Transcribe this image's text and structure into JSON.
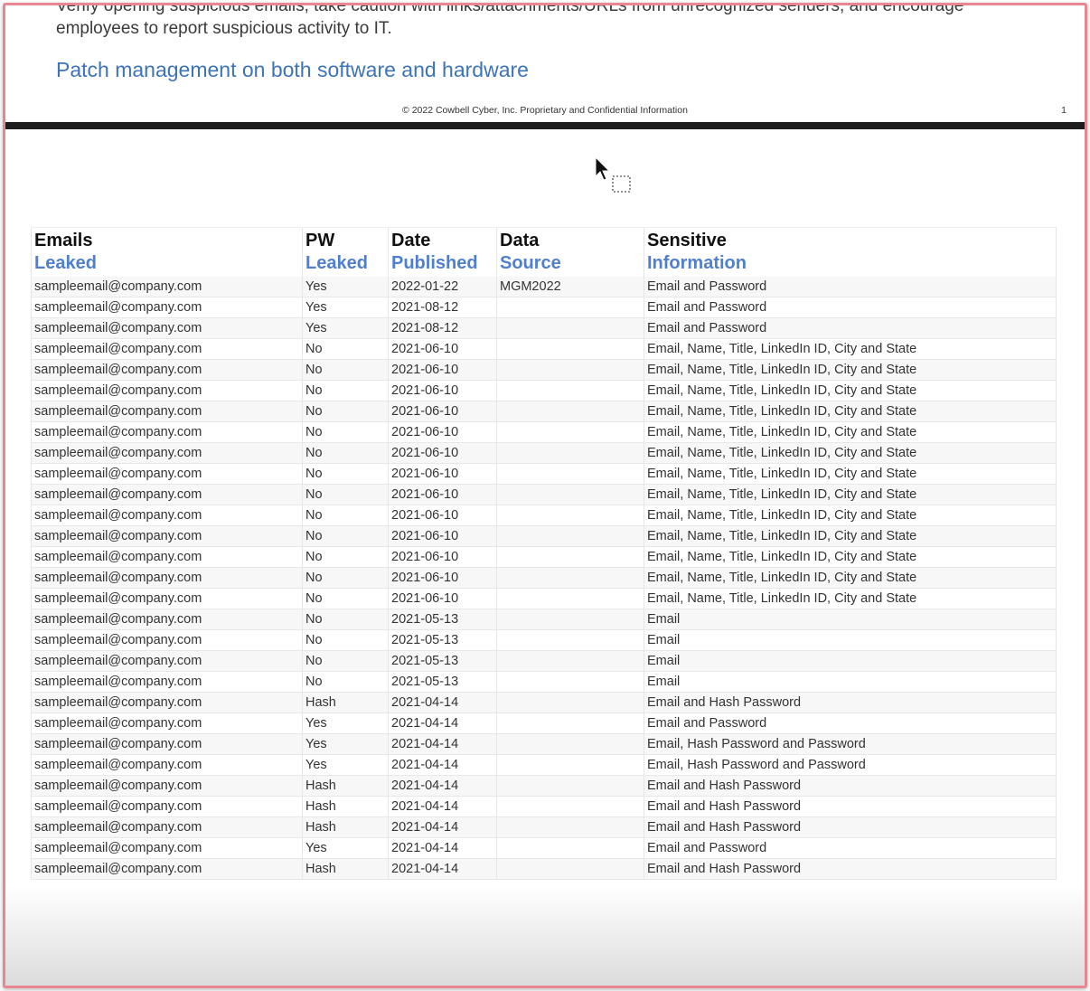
{
  "document": {
    "intro_text": "Verify opening suspicious emails, take caution with links/attachments/URLs from unrecognized senders, and encourage employees to report suspicious activity to IT.",
    "section_heading": "Patch management on both software and hardware",
    "footer_notice": "© 2022 Cowbell Cyber, Inc. Proprietary and Confidential Information",
    "page_number": "1"
  },
  "colors": {
    "heading_blue": "#3d74b8",
    "header_blue": "#4f7fcf",
    "frame_border": "#e8878f",
    "divider": "#1e1e1e"
  },
  "table": {
    "columns": [
      {
        "line1": "Emails",
        "line2": "Leaked"
      },
      {
        "line1": "PW",
        "line2": "Leaked"
      },
      {
        "line1": "Date",
        "line2": "Published"
      },
      {
        "line1": "Data",
        "line2": "Source"
      },
      {
        "line1": "Sensitive",
        "line2": "Information"
      }
    ],
    "rows": [
      [
        "sampleemail@company.com",
        "Yes",
        "2022-01-22",
        "MGM2022",
        "Email and Password"
      ],
      [
        "sampleemail@company.com",
        "Yes",
        "2021-08-12",
        "",
        "Email and Password"
      ],
      [
        "sampleemail@company.com",
        "Yes",
        "2021-08-12",
        "",
        "Email and Password"
      ],
      [
        "sampleemail@company.com",
        "No",
        "2021-06-10",
        "",
        "Email, Name, Title, LinkedIn ID, City and State"
      ],
      [
        "sampleemail@company.com",
        "No",
        "2021-06-10",
        "",
        "Email, Name, Title, LinkedIn ID, City and State"
      ],
      [
        "sampleemail@company.com",
        "No",
        "2021-06-10",
        "",
        "Email, Name, Title, LinkedIn ID, City and State"
      ],
      [
        "sampleemail@company.com",
        "No",
        "2021-06-10",
        "",
        "Email, Name, Title, LinkedIn ID, City and State"
      ],
      [
        "sampleemail@company.com",
        "No",
        "2021-06-10",
        "",
        "Email, Name, Title, LinkedIn ID, City and State"
      ],
      [
        "sampleemail@company.com",
        "No",
        "2021-06-10",
        "",
        "Email, Name, Title, LinkedIn ID, City and State"
      ],
      [
        "sampleemail@company.com",
        "No",
        "2021-06-10",
        "",
        "Email, Name, Title, LinkedIn ID, City and State"
      ],
      [
        "sampleemail@company.com",
        "No",
        "2021-06-10",
        "",
        "Email, Name, Title, LinkedIn ID, City and State"
      ],
      [
        "sampleemail@company.com",
        "No",
        "2021-06-10",
        "",
        "Email, Name, Title, LinkedIn ID, City and State"
      ],
      [
        "sampleemail@company.com",
        "No",
        "2021-06-10",
        "",
        "Email, Name, Title, LinkedIn ID, City and State"
      ],
      [
        "sampleemail@company.com",
        "No",
        "2021-06-10",
        "",
        "Email, Name, Title, LinkedIn ID, City and State"
      ],
      [
        "sampleemail@company.com",
        "No",
        "2021-06-10",
        "",
        "Email, Name, Title, LinkedIn ID, City and State"
      ],
      [
        "sampleemail@company.com",
        "No",
        "2021-06-10",
        "",
        "Email, Name, Title, LinkedIn ID, City and State"
      ],
      [
        "sampleemail@company.com",
        "No",
        "2021-05-13",
        "",
        "Email"
      ],
      [
        "sampleemail@company.com",
        "No",
        "2021-05-13",
        "",
        "Email"
      ],
      [
        "sampleemail@company.com",
        "No",
        "2021-05-13",
        "",
        "Email"
      ],
      [
        "sampleemail@company.com",
        "No",
        "2021-05-13",
        "",
        "Email"
      ],
      [
        "sampleemail@company.com",
        "Hash",
        "2021-04-14",
        "",
        "Email and Hash Password"
      ],
      [
        "sampleemail@company.com",
        "Yes",
        "2021-04-14",
        "",
        "Email and Password"
      ],
      [
        "sampleemail@company.com",
        "Yes",
        "2021-04-14",
        "",
        "Email, Hash Password and Password"
      ],
      [
        "sampleemail@company.com",
        "Yes",
        "2021-04-14",
        "",
        "Email, Hash Password and Password"
      ],
      [
        "sampleemail@company.com",
        "Hash",
        "2021-04-14",
        "",
        "Email and Hash Password"
      ],
      [
        "sampleemail@company.com",
        "Hash",
        "2021-04-14",
        "",
        "Email and Hash Password"
      ],
      [
        "sampleemail@company.com",
        "Hash",
        "2021-04-14",
        "",
        "Email and Hash Password"
      ],
      [
        "sampleemail@company.com",
        "Yes",
        "2021-04-14",
        "",
        "Email and Password"
      ],
      [
        "sampleemail@company.com",
        "Hash",
        "2021-04-14",
        "",
        "Email and Hash Password"
      ]
    ]
  },
  "icons": {
    "cursor": "arrow-cursor-icon"
  }
}
